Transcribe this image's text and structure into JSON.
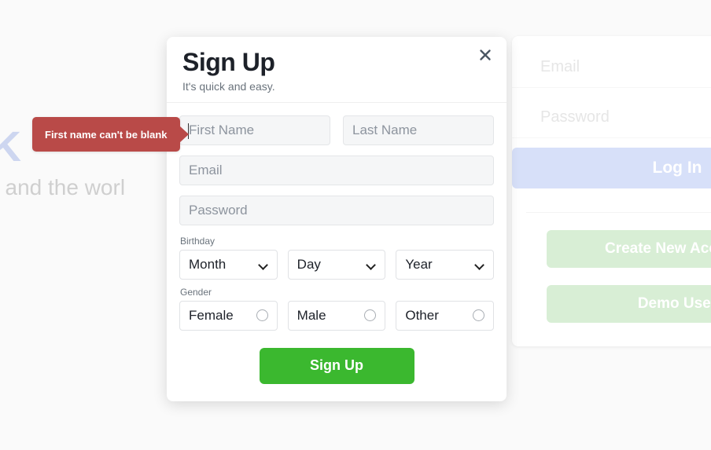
{
  "background": {
    "brand_logo": "WK",
    "tagline": "ends and the worl",
    "login": {
      "email_placeholder": "Email",
      "password_placeholder": "Password",
      "login_label": "Log In",
      "create_account_label": "Create New Account",
      "demo_user_label": "Demo User"
    }
  },
  "tooltip": {
    "message": "First name can't be blank",
    "background_color": "#b94a48",
    "text_color": "#ffffff"
  },
  "modal": {
    "title": "Sign Up",
    "subtitle": "It's quick and easy.",
    "close_icon": "close-icon",
    "fields": {
      "first_name_placeholder": "First Name",
      "last_name_placeholder": "Last Name",
      "email_placeholder": "Email",
      "password_placeholder": "Password"
    },
    "birthday": {
      "label": "Birthday",
      "month_value": "Month",
      "day_value": "Day",
      "year_value": "Year"
    },
    "gender": {
      "label": "Gender",
      "options": [
        "Female",
        "Male",
        "Other"
      ]
    },
    "submit_label": "Sign Up",
    "submit_color": "#3bb82f"
  }
}
